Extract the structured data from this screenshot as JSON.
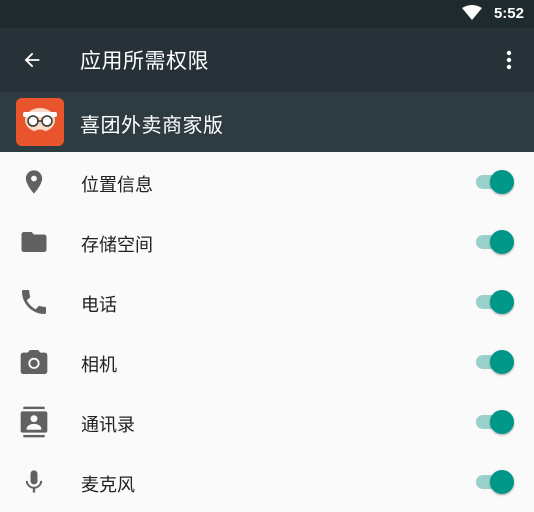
{
  "status_bar": {
    "time": "5:52"
  },
  "app_bar": {
    "title": "应用所需权限"
  },
  "app_header": {
    "name": "喜团外卖商家版"
  },
  "permissions": [
    {
      "label": "位置信息",
      "icon": "location-icon",
      "enabled": true
    },
    {
      "label": "存储空间",
      "icon": "folder-icon",
      "enabled": true
    },
    {
      "label": "电话",
      "icon": "phone-icon",
      "enabled": true
    },
    {
      "label": "相机",
      "icon": "camera-icon",
      "enabled": true
    },
    {
      "label": "通讯录",
      "icon": "contacts-icon",
      "enabled": true
    },
    {
      "label": "麦克风",
      "icon": "microphone-icon",
      "enabled": true
    }
  ],
  "colors": {
    "app_bar": "#263238",
    "header": "#2e3b41",
    "toggle_thumb": "#009688",
    "toggle_track": "#9ad0ca",
    "icon": "#616161"
  }
}
